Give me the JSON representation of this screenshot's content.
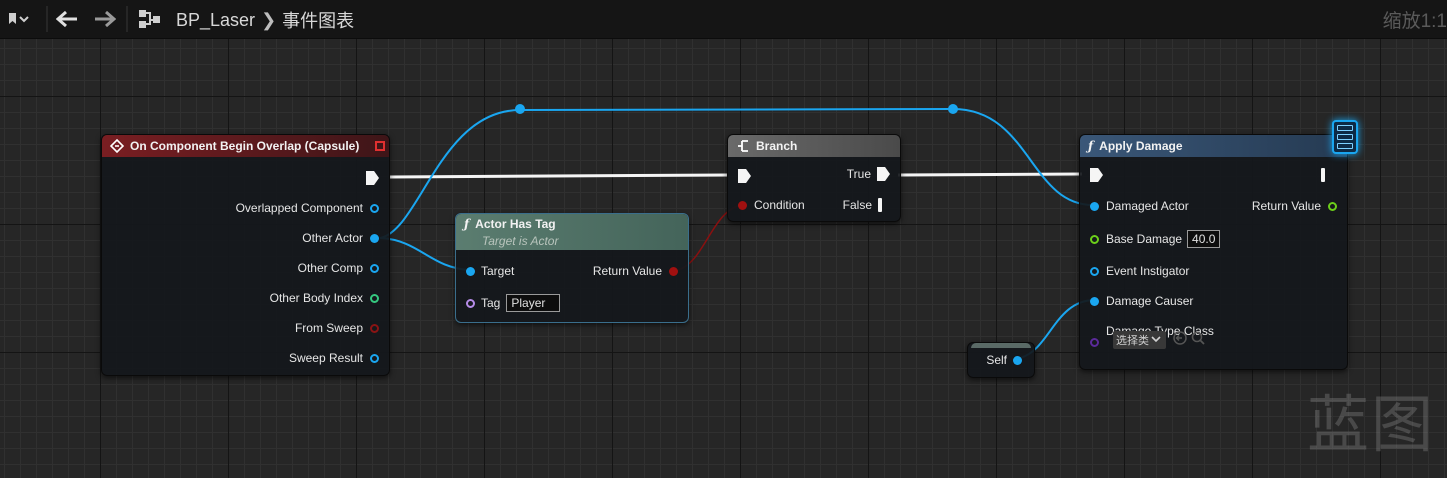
{
  "toolbar": {
    "blueprint_name": "BP_Laser",
    "graph_name": "事件图表",
    "zoom_label": "缩放1:1"
  },
  "watermark": "蓝图",
  "event_node": {
    "title": "On Component Begin Overlap (Capsule)",
    "pins": [
      "Overlapped Component",
      "Other Actor",
      "Other Comp",
      "Other Body Index",
      "From Sweep",
      "Sweep Result"
    ]
  },
  "has_tag_node": {
    "title": "Actor Has Tag",
    "subtitle": "Target is Actor",
    "target_label": "Target",
    "return_label": "Return Value",
    "tag_label": "Tag",
    "tag_value": "Player"
  },
  "branch_node": {
    "title": "Branch",
    "true_label": "True",
    "false_label": "False",
    "condition_label": "Condition"
  },
  "apply_damage_node": {
    "title": "Apply Damage",
    "damaged_actor": "Damaged Actor",
    "return_value": "Return Value",
    "base_damage": "Base Damage",
    "base_damage_value": "40.0",
    "event_instigator": "Event Instigator",
    "damage_causer": "Damage Causer",
    "damage_type_class": "Damage Type Class",
    "class_dropdown": "选择类"
  },
  "self_node": {
    "label": "Self"
  },
  "colors": {
    "event_header": "#6e1c1c",
    "function_header": "#2e4a6a",
    "has_tag_header": "#4b6a5d",
    "branch_header": "#5a5a5a",
    "wire_blue": "#1aa6f0",
    "wire_exec": "#f5f5f5",
    "wire_bool": "#8a1010"
  }
}
